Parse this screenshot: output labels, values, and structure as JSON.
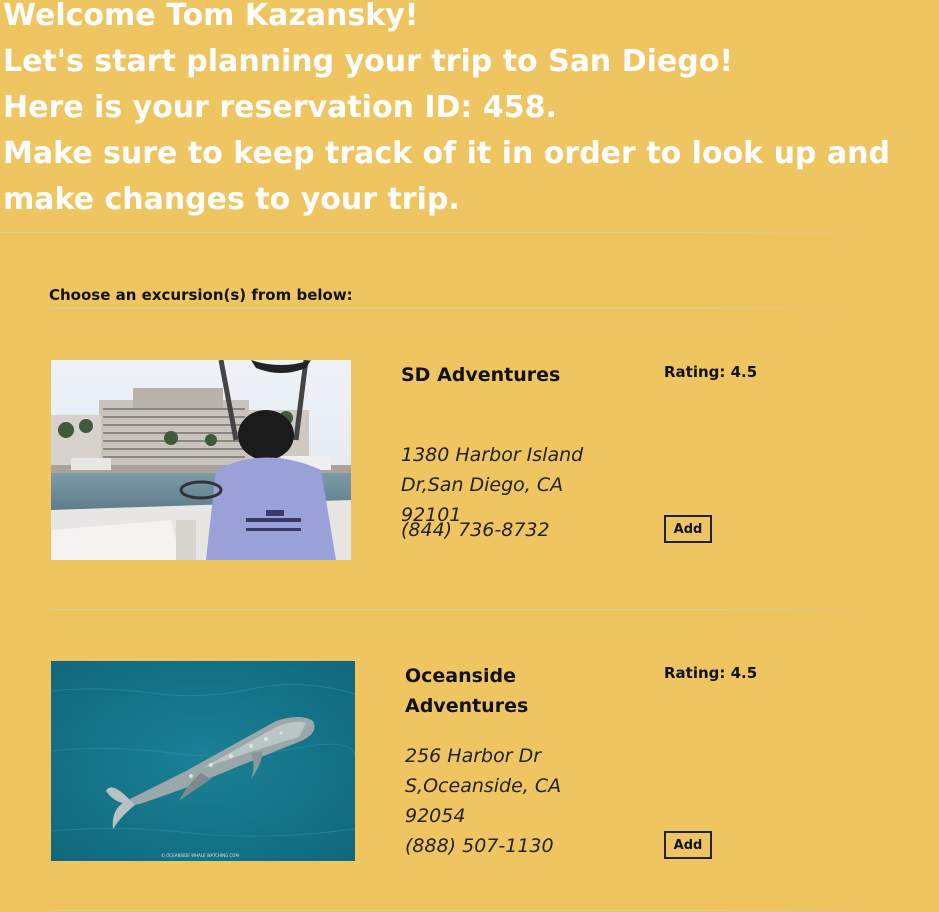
{
  "welcome": {
    "line1": "Welcome Tom Kazansky!",
    "line2": "Let's start planning your trip to San Diego!",
    "line3": "Here is your reservation ID: 458.",
    "line4": "Make sure to keep track of it in order to look up and make changes to your trip."
  },
  "excursions": {
    "heading": "Choose an excursion(s) from below:",
    "items": [
      {
        "name": "SD Adventures",
        "rating": "Rating: 4.5",
        "address": "1380 Harbor Island Dr,San Diego, CA 92101",
        "phone": "(844) 736-8732",
        "add_label": "Add",
        "image": "boat-tour-photo"
      },
      {
        "name": "Oceanside Adventures",
        "rating": "Rating: 4.5",
        "address": "256 Harbor Dr S,Oceanside, CA 92054",
        "phone": "(888) 507-1130",
        "add_label": "Add",
        "image": "gray-whale-photo"
      }
    ]
  },
  "colors": {
    "background": "#efc561",
    "welcome_text": "#ffffff"
  }
}
